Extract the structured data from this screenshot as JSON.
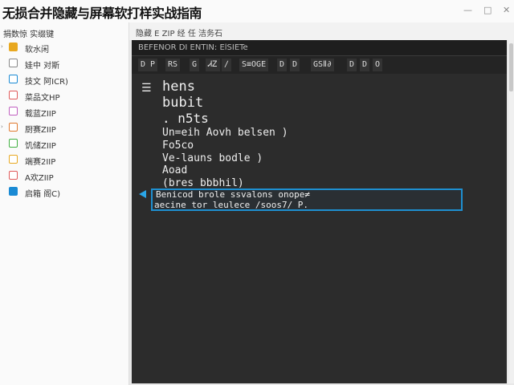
{
  "title": "无损合并隐藏与屏幕软打样实战指南",
  "window_buttons": [
    "—",
    "□",
    "✕"
  ],
  "sidebar": {
    "header": "捐数惊 实缀键",
    "items": [
      {
        "label": "软水闲",
        "icon": "folder-icon",
        "color": "#e8a820",
        "arrow": "›"
      },
      {
        "label": "娃中 对斯",
        "icon": "file-icon",
        "color": "#888888",
        "arrow": ""
      },
      {
        "label": "技文 阿ICR)",
        "icon": "document-icon",
        "color": "#1a8ad4",
        "arrow": ""
      },
      {
        "label": "菜品文HP",
        "icon": "image-icon",
        "color": "#e05a5a",
        "arrow": ""
      },
      {
        "label": "载蓝ZIIP",
        "icon": "archive-icon",
        "color": "#c060c0",
        "arrow": ""
      },
      {
        "label": "厨赛ZIIP",
        "icon": "archive-icon",
        "color": "#e07a30",
        "arrow": "›"
      },
      {
        "label": "饥储ZIIP",
        "icon": "archive-icon",
        "color": "#40b040",
        "arrow": ""
      },
      {
        "label": "端赛2IIP",
        "icon": "archive-icon",
        "color": "#e8a820",
        "arrow": ""
      },
      {
        "label": "A欢ZIIP",
        "icon": "archive-icon",
        "color": "#e05a5a",
        "arrow": ""
      },
      {
        "label": "启箱 阁C)",
        "icon": "folder-icon",
        "color": "#1a8ad4",
        "arrow": ""
      }
    ]
  },
  "path_bar": "隐藏 E ZIP 经 任 洁务石",
  "editor": {
    "top_label": "BEFENOR DI ENTIN: ElSIETe",
    "toolbar": [
      "D P",
      "RS",
      "G",
      "ᏗᏃ",
      "∕",
      "S≡OGE",
      "D",
      "D",
      "GSⅡ∂",
      "D",
      "D",
      "O"
    ],
    "lines": [
      {
        "text": "hens",
        "size": 17
      },
      {
        "text": "bubit",
        "size": 17
      },
      {
        "text": ". n5ts",
        "size": 16
      },
      {
        "text": "Un=eih Aovh belsen )",
        "size": 13
      },
      {
        "text": "Fo5co",
        "size": 13
      },
      {
        "text": "Ve-launs bodle )",
        "size": 13
      },
      {
        "text": "Aoad",
        "size": 13
      },
      {
        "text": "(bres bbbhil)",
        "size": 13
      }
    ],
    "selected_lines": [
      "Benicod brole ssvalons onope≠",
      "aecine tor leulece /soos7/ P."
    ]
  }
}
